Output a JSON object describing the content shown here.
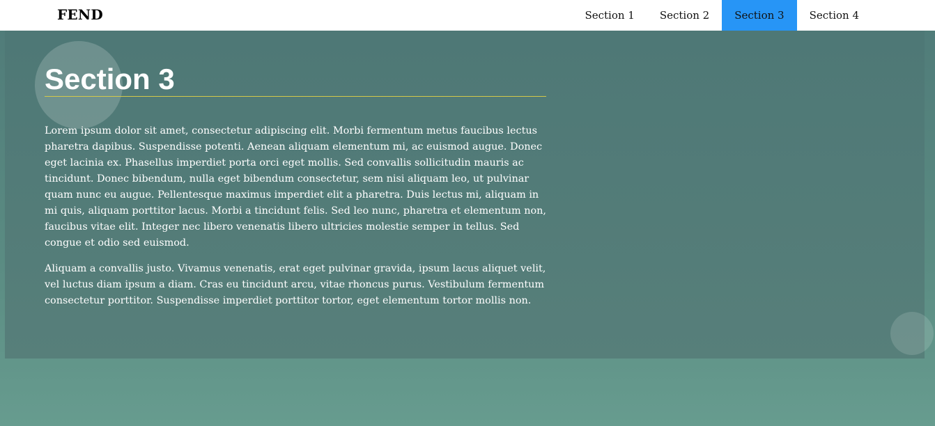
{
  "navbar": {
    "logo": "FEND",
    "items": [
      {
        "label": "Section 1",
        "active": false
      },
      {
        "label": "Section 2",
        "active": false
      },
      {
        "label": "Section 3",
        "active": true
      },
      {
        "label": "Section 4",
        "active": false
      }
    ],
    "active_color": "#2795f6"
  },
  "section": {
    "title": "Section 3",
    "paragraphs": [
      "Lorem ipsum dolor sit amet, consectetur adipiscing elit. Morbi fermentum metus faucibus lectus pharetra dapibus. Suspendisse potenti. Aenean aliquam elementum mi, ac euismod augue. Donec eget lacinia ex. Phasellus imperdiet porta orci eget mollis. Sed convallis sollicitudin mauris ac tincidunt. Donec bibendum, nulla eget bibendum consectetur, sem nisi aliquam leo, ut pulvinar quam nunc eu augue. Pellentesque maximus imperdiet elit a pharetra. Duis lectus mi, aliquam in mi quis, aliquam porttitor lacus. Morbi a tincidunt felis. Sed leo nunc, pharetra et elementum non, faucibus vitae elit. Integer nec libero venenatis libero ultricies molestie semper in tellus. Sed congue et odio sed euismod.",
      "Aliquam a convallis justo. Vivamus venenatis, erat eget pulvinar gravida, ipsum lacus aliquet velit, vel luctus diam ipsum a diam. Cras eu tincidunt arcu, vitae rhoncus purus. Vestibulum fermentum consectetur porttitor. Suspendisse imperdiet porttitor tortor, eget elementum tortor mollis non."
    ]
  }
}
